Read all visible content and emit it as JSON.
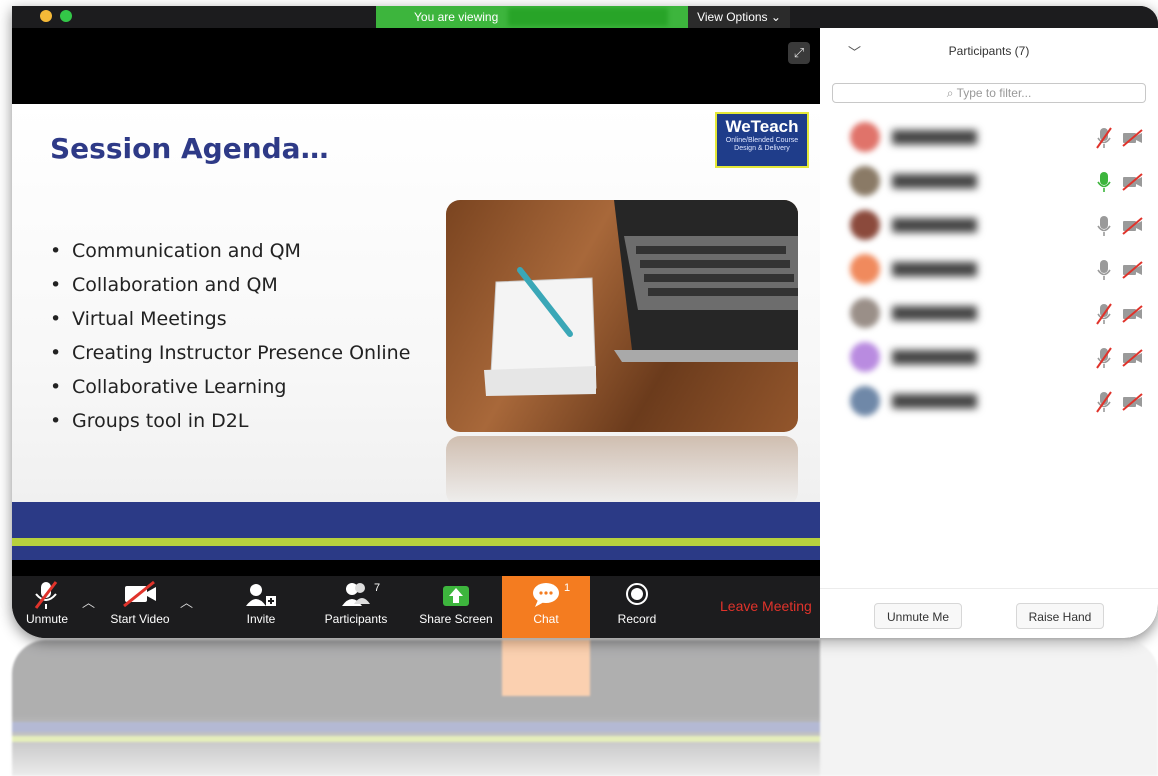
{
  "window": {
    "sharing_banner": "You are viewing",
    "view_options": "View Options ⌄"
  },
  "slide": {
    "title": "Session Agenda…",
    "logo_name": "WeTeach",
    "logo_tagline": "Online/Blended Course Design & Delivery",
    "bullets": [
      "Communication and QM",
      "Collaboration and QM",
      "Virtual Meetings",
      "Creating Instructor Presence Online",
      "Collaborative Learning",
      "Groups tool in D2L"
    ]
  },
  "toolbar": {
    "unmute": "Unmute",
    "start_video": "Start Video",
    "invite": "Invite",
    "participants": "Participants",
    "participants_count": "7",
    "share_screen": "Share Screen",
    "chat": "Chat",
    "chat_badge": "1",
    "record": "Record",
    "leave": "Leave Meeting"
  },
  "panel": {
    "title": "Participants (7)",
    "filter_placeholder": "Type to filter...",
    "participants": [
      {
        "avatar_color": "#e0736a",
        "mic": "muted",
        "video": "off"
      },
      {
        "avatar_color": "#8a7a66",
        "mic": "active",
        "video": "off"
      },
      {
        "avatar_color": "#8b4a3c",
        "mic": "on",
        "video": "off"
      },
      {
        "avatar_color": "#f08a5d",
        "mic": "on",
        "video": "off"
      },
      {
        "avatar_color": "#9a8f88",
        "mic": "muted",
        "video": "off"
      },
      {
        "avatar_color": "#b98be0",
        "mic": "muted",
        "video": "off"
      },
      {
        "avatar_color": "#6f88a8",
        "mic": "muted",
        "video": "off"
      }
    ],
    "unmute_me": "Unmute Me",
    "raise_hand": "Raise Hand"
  },
  "colors": {
    "sharing_green": "#3db53d",
    "chat_orange": "#f47c20",
    "leave_red": "#e0332b",
    "slide_navy": "#2b3a86",
    "slide_lime": "#b7d13e"
  }
}
